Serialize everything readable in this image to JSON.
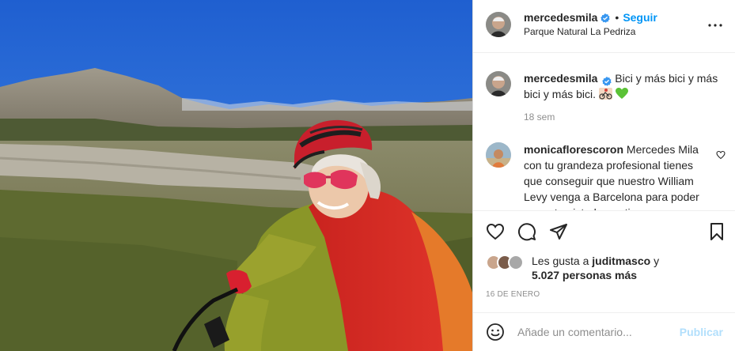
{
  "header": {
    "username": "mercedesmila",
    "follow_label": "Seguir",
    "separator": "•",
    "location": "Parque Natural La Pedriza"
  },
  "caption": {
    "username": "mercedesmila",
    "text": "Bici y más bici y más bici y más bici.",
    "emoji": [
      "person-biking-emoji",
      "green-heart-emoji"
    ],
    "time": "18 sem"
  },
  "comments": [
    {
      "username": "monicaflorescoron",
      "text": "Mercedes Mila con tu grandeza profesional tienes que conseguir que nuestro William Levy venga a Barcelona para poder ser entrevistado por ti"
    }
  ],
  "likes": {
    "prefix": "Les gusta a",
    "user": "juditmasco",
    "conjunction": "y",
    "count_text": "5.027 personas más"
  },
  "date": "16 DE ENERO",
  "composer": {
    "placeholder": "Añade un comentario...",
    "publish_label": "Publicar"
  },
  "icons": {
    "like": "heart-icon",
    "comment": "comment-icon",
    "share": "share-icon",
    "save": "bookmark-icon",
    "more": "more-options-icon",
    "emoji": "emoji-icon",
    "verified": "verified-badge-icon"
  },
  "colors": {
    "accent": "#0095f6",
    "publish_disabled": "#b2dffc",
    "muted": "#8e8e8e",
    "verified": "#3897f0",
    "text": "#262626"
  }
}
